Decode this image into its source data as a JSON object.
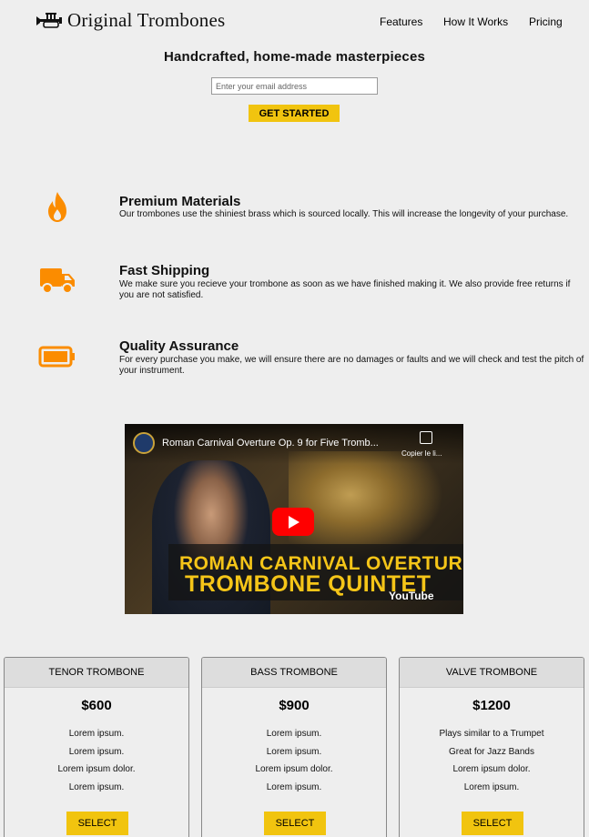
{
  "header": {
    "brand": "Original Trombones",
    "nav": [
      {
        "label": "Features"
      },
      {
        "label": "How It Works"
      },
      {
        "label": "Pricing"
      }
    ]
  },
  "hero": {
    "title": "Handcrafted, home-made masterpieces",
    "email_placeholder": "Enter your email address",
    "cta_label": "GET STARTED"
  },
  "features": [
    {
      "icon": "flame-icon",
      "title": "Premium Materials",
      "desc": "Our trombones use the shiniest brass which is sourced locally. This will increase the longevity of your purchase."
    },
    {
      "icon": "truck-icon",
      "title": "Fast Shipping",
      "desc": "We make sure you recieve your trombone as soon as we have finished making it. We also provide free returns if you are not satisfied."
    },
    {
      "icon": "battery-icon",
      "title": "Quality Assurance",
      "desc": "For every purchase you make, we will ensure there are no damages or faults and we will check and test the pitch of your instrument."
    }
  ],
  "video": {
    "title": "Roman Carnival Overture Op. 9 for Five Tromb...",
    "copy_label": "Copier le li...",
    "overlay_line1": "ROMAN CARNIVAL OVERTURE",
    "overlay_line2": "TROMBONE QUINTET",
    "platform": "YouTube"
  },
  "pricing": [
    {
      "name": "TENOR TROMBONE",
      "price": "$600",
      "features": [
        "Lorem ipsum.",
        "Lorem ipsum.",
        "Lorem ipsum dolor.",
        "Lorem ipsum."
      ],
      "button": "SELECT"
    },
    {
      "name": "BASS TROMBONE",
      "price": "$900",
      "features": [
        "Lorem ipsum.",
        "Lorem ipsum.",
        "Lorem ipsum dolor.",
        "Lorem ipsum."
      ],
      "button": "SELECT"
    },
    {
      "name": "VALVE TROMBONE",
      "price": "$1200",
      "features": [
        "Plays similar to a Trumpet",
        "Great for Jazz Bands",
        "Lorem ipsum dolor.",
        "Lorem ipsum."
      ],
      "button": "SELECT"
    }
  ],
  "colors": {
    "accent": "#f1c40f",
    "icon_orange": "#fb8c00",
    "background": "#eeeeee"
  }
}
